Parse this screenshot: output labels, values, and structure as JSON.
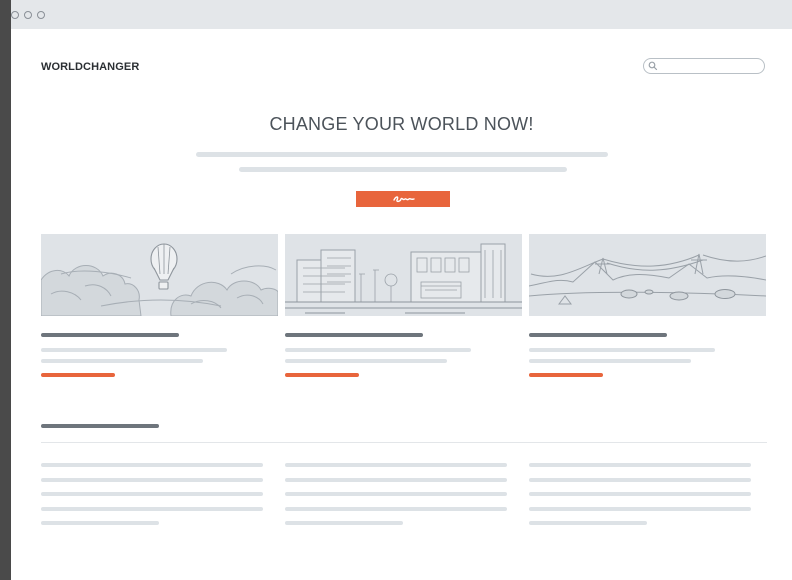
{
  "window": {
    "controls": [
      "close",
      "minimize",
      "maximize"
    ]
  },
  "header": {
    "logo": "WORLDCHANGER",
    "search": {
      "placeholder": "",
      "icon": "search-icon"
    }
  },
  "hero": {
    "title": "CHANGE YOUR WORLD NOW!",
    "cta_icon": "signature-scribble-icon"
  },
  "cards": [
    {
      "illustration": "hot-air-balloon-over-clouds"
    },
    {
      "illustration": "city-buildings-street"
    },
    {
      "illustration": "desert-power-lines-rocks"
    }
  ],
  "colors": {
    "accent": "#e8653c",
    "placeholder_light": "#dde2e6",
    "placeholder_dark": "#6e757c",
    "titlebar": "#e4e7ea"
  }
}
